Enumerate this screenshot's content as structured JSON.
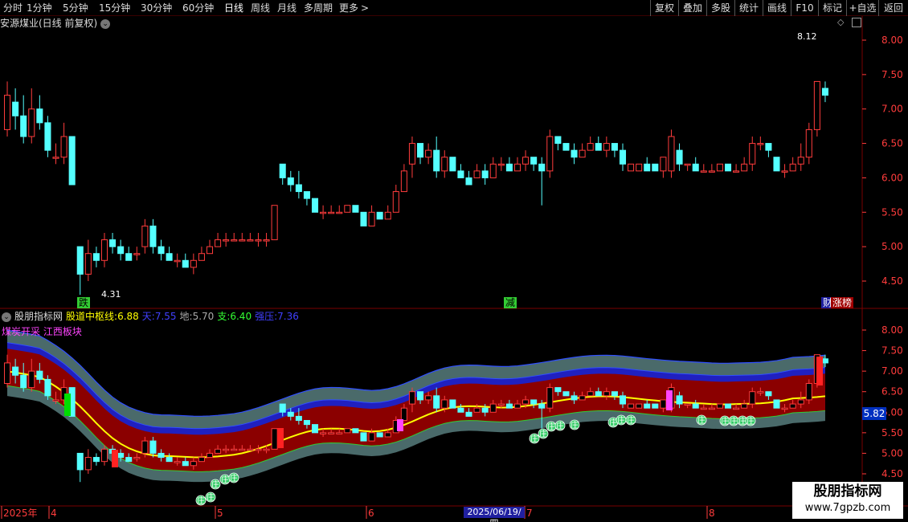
{
  "toolbar": {
    "left_tabs": [
      "分时",
      "1分钟",
      "5分钟",
      "15分钟",
      "30分钟",
      "60分钟",
      "日线",
      "周线",
      "月线",
      "多周期",
      "更多"
    ],
    "active_tab": "日线",
    "more_arrow": ">",
    "right_buttons": [
      "复权",
      "叠加",
      "多股",
      "统计",
      "画线",
      "F10",
      "标记",
      "+自选",
      "返回"
    ]
  },
  "main_chart": {
    "title": "安源煤业(日线 前复权)",
    "y_ticks": [
      "8.00",
      "7.50",
      "7.00",
      "6.50",
      "6.00",
      "5.50",
      "5.00",
      "4.50"
    ],
    "high_annotation": "8.12",
    "low_annotation": "4.31",
    "signals": [
      {
        "text": "跌",
        "color": "#000000",
        "bg": "#33cc33"
      },
      {
        "text": "减",
        "color": "#000000",
        "bg": "#33cc33"
      },
      {
        "text": "财",
        "color": "#ffffff",
        "bg": "#2020a0"
      },
      {
        "text": "涨榜",
        "color": "#ffffff",
        "bg": "#a00000"
      }
    ]
  },
  "indicator": {
    "name": "股朋指标网",
    "line_label": "股道中枢线:",
    "line_value": "6.88",
    "sky_label": "天:",
    "sky_value": "7.55",
    "ground_label": "地:",
    "ground_value": "5.70",
    "support_label": "支:",
    "support_value": "6.40",
    "pressure_label": "强压:",
    "pressure_value": "7.36",
    "sector": "煤炭开采 江西板块",
    "y_ticks": [
      "8.00",
      "7.50",
      "7.00",
      "6.50",
      "6.00",
      "5.50",
      "5.00",
      "4.50"
    ],
    "current_price": "5.82",
    "zhuang_marker": "庄"
  },
  "time_axis": {
    "labels": [
      "2025年",
      "4",
      "5",
      "6",
      "7",
      "8"
    ],
    "highlight": "2025/06/19/四"
  },
  "watermark": {
    "line1": "股朋指标网",
    "line2": "www.7gpzb.com"
  },
  "colors": {
    "up": "#ff3c3c",
    "down": "#54ffff",
    "center_line": "#ffff00",
    "band_outer": "#4a6a6a",
    "band_mid": "#8b0000",
    "band_blue": "#2020c0"
  },
  "chart_data": {
    "type": "candlestick",
    "title": "安源煤业(日线 前复权)",
    "ylim": [
      4.2,
      8.3
    ],
    "high": 8.12,
    "low": 4.31,
    "candles": [
      [
        6.7,
        7.2,
        7.4,
        6.6
      ],
      [
        7.1,
        6.9,
        7.3,
        6.7
      ],
      [
        6.9,
        6.6,
        7.2,
        6.5
      ],
      [
        6.6,
        7.0,
        7.3,
        6.5
      ],
      [
        7.0,
        6.8,
        7.2,
        6.7
      ],
      [
        6.8,
        6.4,
        6.9,
        6.3
      ],
      [
        6.3,
        6.3,
        6.5,
        6.2
      ],
      [
        6.3,
        6.6,
        6.8,
        6.2
      ],
      [
        6.6,
        5.9,
        6.6,
        5.9
      ],
      [
        5.0,
        4.6,
        5.0,
        4.3
      ],
      [
        4.6,
        4.9,
        5.1,
        4.5
      ],
      [
        4.9,
        4.8,
        5.0,
        4.7
      ],
      [
        4.8,
        5.1,
        5.2,
        4.7
      ],
      [
        5.1,
        5.0,
        5.2,
        4.9
      ],
      [
        5.0,
        4.9,
        5.1,
        4.8
      ],
      [
        4.9,
        4.8,
        5.0,
        4.8
      ],
      [
        4.9,
        4.9,
        5.0,
        4.8
      ],
      [
        5.0,
        5.3,
        5.4,
        4.9
      ],
      [
        5.3,
        5.0,
        5.4,
        4.9
      ],
      [
        5.0,
        4.9,
        5.1,
        4.8
      ],
      [
        4.9,
        4.8,
        5.0,
        4.8
      ],
      [
        4.8,
        4.8,
        4.9,
        4.7
      ],
      [
        4.8,
        4.7,
        4.9,
        4.7
      ],
      [
        4.7,
        4.8,
        4.9,
        4.6
      ],
      [
        4.8,
        4.9,
        5.0,
        4.8
      ],
      [
        4.9,
        5.0,
        5.1,
        4.9
      ],
      [
        5.0,
        5.1,
        5.2,
        5.0
      ],
      [
        5.1,
        5.1,
        5.2,
        5.0
      ],
      [
        5.1,
        5.1,
        5.2,
        5.1
      ],
      [
        5.1,
        5.1,
        5.2,
        5.1
      ],
      [
        5.1,
        5.1,
        5.2,
        5.1
      ],
      [
        5.1,
        5.1,
        5.2,
        5.0
      ],
      [
        5.1,
        5.1,
        5.2,
        5.0
      ],
      [
        5.1,
        5.6,
        5.6,
        5.1
      ],
      [
        6.2,
        6.0,
        6.2,
        5.9
      ],
      [
        6.0,
        5.9,
        6.1,
        5.8
      ],
      [
        5.9,
        5.8,
        6.1,
        5.7
      ],
      [
        5.8,
        5.7,
        5.8,
        5.6
      ],
      [
        5.7,
        5.5,
        5.7,
        5.5
      ],
      [
        5.5,
        5.5,
        5.6,
        5.4
      ],
      [
        5.5,
        5.5,
        5.6,
        5.5
      ],
      [
        5.5,
        5.5,
        5.6,
        5.5
      ],
      [
        5.5,
        5.6,
        5.6,
        5.5
      ],
      [
        5.6,
        5.5,
        5.6,
        5.5
      ],
      [
        5.5,
        5.3,
        5.5,
        5.3
      ],
      [
        5.3,
        5.5,
        5.6,
        5.3
      ],
      [
        5.5,
        5.4,
        5.5,
        5.4
      ],
      [
        5.4,
        5.5,
        5.6,
        5.4
      ],
      [
        5.5,
        5.8,
        5.9,
        5.5
      ],
      [
        5.8,
        6.1,
        6.2,
        5.8
      ],
      [
        6.2,
        6.5,
        6.6,
        6.0
      ],
      [
        6.5,
        6.3,
        6.5,
        6.2
      ],
      [
        6.3,
        6.4,
        6.5,
        6.2
      ],
      [
        6.4,
        6.1,
        6.6,
        6.0
      ],
      [
        6.1,
        6.3,
        6.4,
        6.0
      ],
      [
        6.3,
        6.1,
        6.3,
        6.1
      ],
      [
        6.1,
        6.0,
        6.2,
        6.0
      ],
      [
        6.0,
        5.9,
        6.1,
        5.9
      ],
      [
        6.0,
        6.1,
        6.2,
        6.0
      ],
      [
        6.1,
        6.0,
        6.2,
        5.9
      ],
      [
        6.0,
        6.2,
        6.3,
        6.0
      ],
      [
        6.2,
        6.2,
        6.3,
        6.1
      ],
      [
        6.2,
        6.1,
        6.3,
        6.1
      ],
      [
        6.1,
        6.2,
        6.3,
        6.1
      ],
      [
        6.2,
        6.3,
        6.4,
        6.1
      ],
      [
        6.3,
        6.2,
        6.3,
        6.1
      ],
      [
        6.2,
        6.1,
        6.3,
        5.6
      ],
      [
        6.1,
        6.6,
        6.7,
        6.0
      ],
      [
        6.6,
        6.5,
        6.6,
        6.4
      ],
      [
        6.5,
        6.4,
        6.5,
        6.4
      ],
      [
        6.4,
        6.3,
        6.5,
        6.2
      ],
      [
        6.3,
        6.4,
        6.5,
        6.3
      ],
      [
        6.4,
        6.5,
        6.6,
        6.4
      ],
      [
        6.5,
        6.4,
        6.6,
        6.4
      ],
      [
        6.4,
        6.5,
        6.6,
        6.3
      ],
      [
        6.5,
        6.4,
        6.5,
        6.3
      ],
      [
        6.4,
        6.2,
        6.5,
        6.1
      ],
      [
        6.1,
        6.2,
        6.2,
        6.1
      ],
      [
        6.1,
        6.2,
        6.2,
        6.1
      ],
      [
        6.2,
        6.1,
        6.3,
        6.1
      ],
      [
        6.2,
        6.1,
        6.2,
        6.1
      ],
      [
        6.1,
        6.3,
        6.3,
        6.0
      ],
      [
        6.1,
        6.6,
        6.7,
        6.0
      ],
      [
        6.4,
        6.2,
        6.5,
        6.1
      ],
      [
        6.2,
        6.2,
        6.2,
        6.1
      ],
      [
        6.2,
        6.1,
        6.3,
        6.1
      ],
      [
        6.1,
        6.1,
        6.2,
        6.1
      ],
      [
        6.1,
        6.1,
        6.2,
        6.1
      ],
      [
        6.1,
        6.2,
        6.2,
        6.1
      ],
      [
        6.2,
        6.1,
        6.2,
        6.1
      ],
      [
        6.1,
        6.1,
        6.2,
        6.1
      ],
      [
        6.1,
        6.2,
        6.3,
        6.1
      ],
      [
        6.2,
        6.5,
        6.6,
        6.1
      ],
      [
        6.5,
        6.5,
        6.6,
        6.4
      ],
      [
        6.5,
        6.4,
        6.5,
        6.3
      ],
      [
        6.3,
        6.1,
        6.3,
        6.1
      ],
      [
        6.1,
        6.1,
        6.2,
        6.0
      ],
      [
        6.1,
        6.2,
        6.3,
        6.1
      ],
      [
        6.2,
        6.3,
        6.5,
        6.1
      ],
      [
        6.3,
        6.7,
        6.8,
        6.2
      ],
      [
        6.7,
        7.4,
        7.4,
        6.6
      ],
      [
        7.3,
        7.2,
        7.4,
        7.1
      ]
    ]
  }
}
